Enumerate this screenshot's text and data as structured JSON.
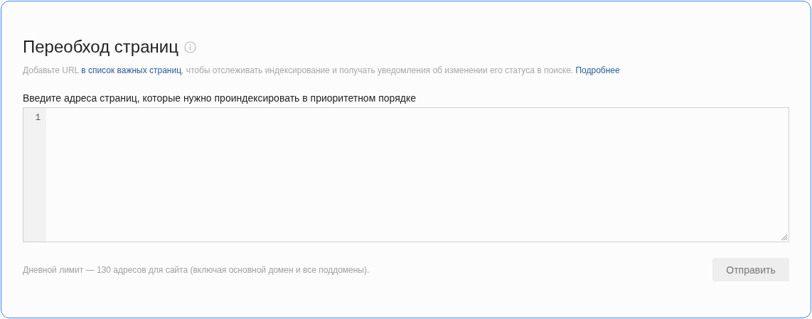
{
  "title": "Переобход страниц",
  "description": [
    {
      "kind": "text",
      "text": "Добавьте URL "
    },
    {
      "kind": "link",
      "text": "в список важных страниц"
    },
    {
      "kind": "text",
      "text": ", чтобы отслеживать индексирование и получать уведомления об изменении его статуса в поиске. "
    },
    {
      "kind": "link",
      "text": "Подробнее"
    }
  ],
  "urls_field": {
    "label": "Введите адреса страниц, которые нужно проиндексировать в приоритетном порядке",
    "line_numbers": [
      "1"
    ]
  },
  "limit_note": "Дневной лимит — 130 адресов для сайта (включая основной домен и все поддомены).",
  "submit_button": {
    "label": "Отправить",
    "disabled": true
  }
}
